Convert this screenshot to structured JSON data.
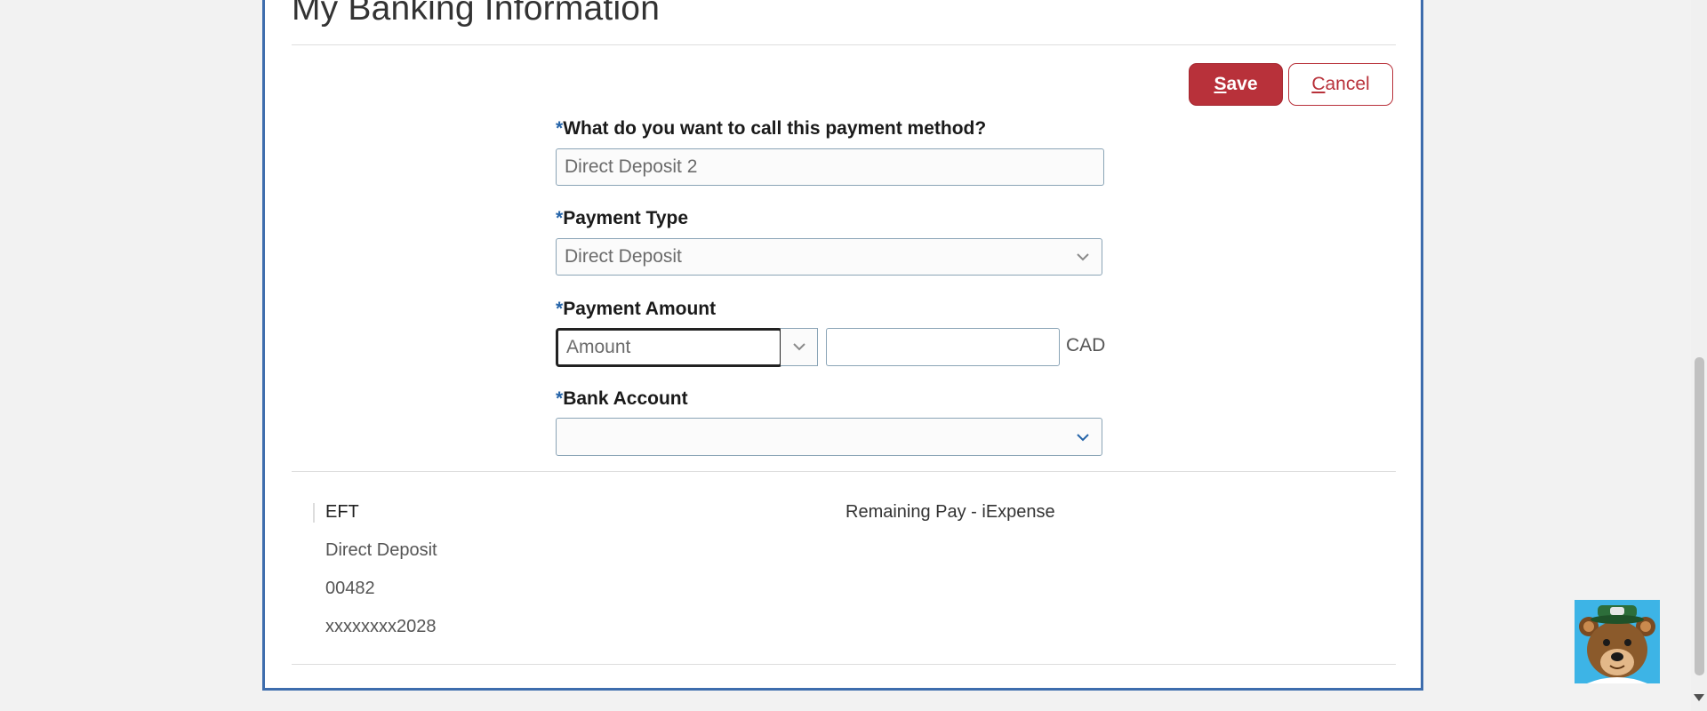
{
  "page": {
    "title": "My Banking Information"
  },
  "toolbar": {
    "save_accesskey": "S",
    "save_rest": "ave",
    "cancel_accesskey": "C",
    "cancel_rest": "ancel"
  },
  "form": {
    "required_marker": "*",
    "payment_method_name": {
      "label": "What do you want to call this payment method?",
      "value": "Direct Deposit 2"
    },
    "payment_type": {
      "label": "Payment Type",
      "value": "Direct Deposit"
    },
    "payment_amount": {
      "label": "Payment Amount",
      "type_value": "Amount",
      "amount_value": "",
      "currency": "CAD"
    },
    "bank_account": {
      "label": "Bank Account",
      "value": ""
    }
  },
  "existing_method": {
    "name": "EFT",
    "type": "Direct Deposit",
    "bank_code": "00482",
    "account": "xxxxxxxx2028",
    "distribution": "Remaining Pay - iExpense"
  },
  "icons": {
    "dropdown": "chevron-down-icon",
    "mascot": "bear-mascot-icon",
    "scroll_down": "scroll-down-arrow-icon"
  },
  "colors": {
    "save_button": "#b8313a",
    "required_marker": "#2463a8",
    "panel_border": "#3e6dad",
    "mascot_background": "#3db4e6"
  }
}
